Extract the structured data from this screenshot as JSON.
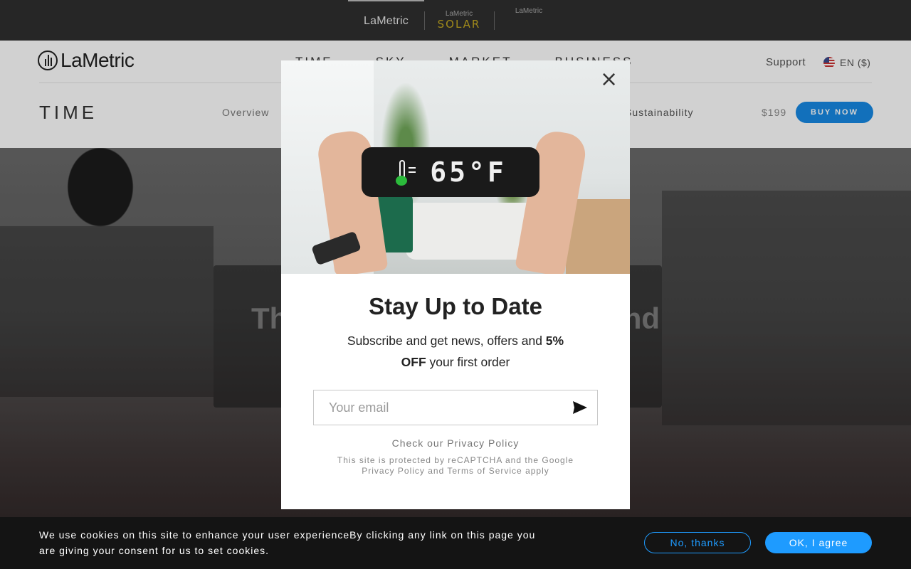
{
  "brand_bar": {
    "tabs": [
      {
        "label": "LaMetric",
        "sub": ""
      },
      {
        "label": "LaMetric",
        "sub": "SOLAR"
      },
      {
        "label": "LaMetric",
        "sub": ""
      }
    ]
  },
  "header": {
    "logo_text": "LaMetric",
    "nav": [
      "TIME",
      "SKY",
      "MARKET",
      "BUSINESS"
    ],
    "support": "Support",
    "language": "EN ($)",
    "product_title": "TIME",
    "subnav": [
      "Overview"
    ],
    "subnav_right": "Sustainability",
    "price": "$199",
    "buy_now": "BUY NOW"
  },
  "hero": {
    "title_left": "Th",
    "title_right": "nd"
  },
  "modal": {
    "device_temp": "65°F",
    "title": "Stay Up to Date",
    "desc_part1": "Subscribe and get news, offers and ",
    "desc_bold1": "5% OFF",
    "desc_part2": " your first order",
    "email_placeholder": "Your email",
    "privacy": "Check our Privacy Policy",
    "recaptcha": "This site is protected by reCAPTCHA and the Google Privacy Policy and Terms of Service apply",
    "close_icon": "close-icon",
    "send_icon": "send-icon"
  },
  "cookie": {
    "text": "We use cookies on this site to enhance your user experienceBy clicking any link on this page you are giving your consent for us to set cookies.",
    "no_label": "No, thanks",
    "ok_label": "OK, I agree"
  },
  "colors": {
    "accent": "#1e9bff",
    "buy_button": "#1689e4",
    "cookie_bg": "#141414"
  }
}
